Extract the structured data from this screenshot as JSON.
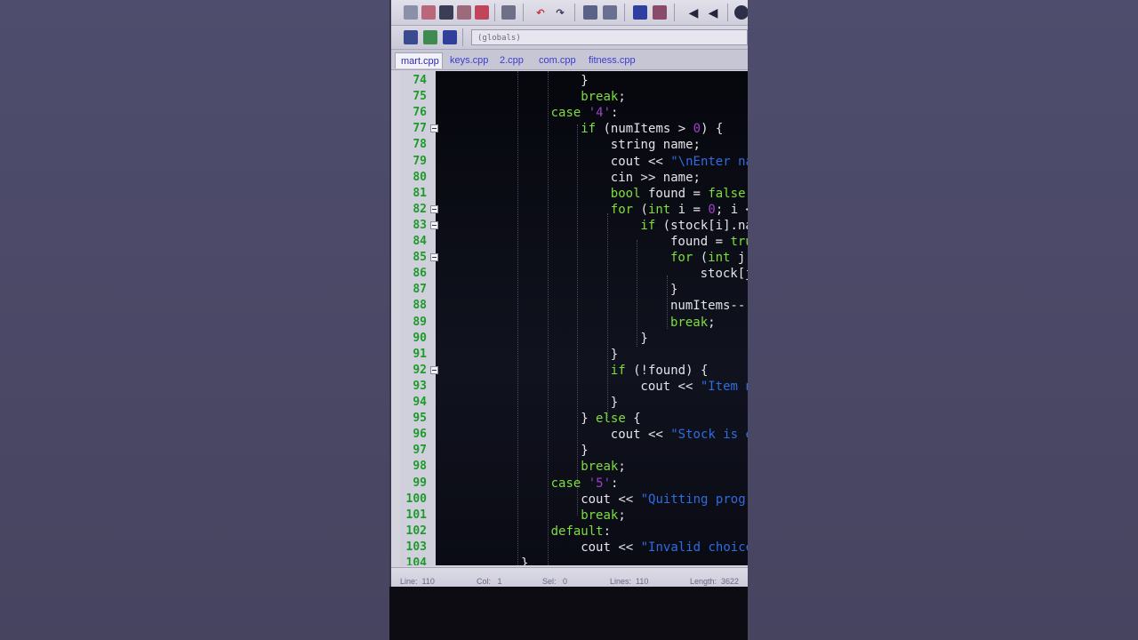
{
  "window": {
    "scope": "(globals)",
    "tabs": [
      "mart.cpp",
      "keys.cpp",
      "2.cpp",
      "com.cpp",
      "fitness.cpp"
    ]
  },
  "toolbar": {
    "icons": [
      "new-file-icon",
      "open-file-icon",
      "save-icon",
      "save-all-icon",
      "close-icon",
      "print-icon",
      "undo-icon",
      "redo-icon",
      "find-icon",
      "replace-icon",
      "indent-icon",
      "unindent-icon",
      "bookmark-icon",
      "bookmark-next-icon",
      "debug-icon"
    ]
  },
  "code": [
    {
      "ln": "74",
      "indent": 18,
      "tokens": [
        [
          "}",
          ""
        ]
      ]
    },
    {
      "ln": "75",
      "indent": 18,
      "tokens": [
        [
          "break",
          "kw"
        ],
        [
          ";",
          ""
        ]
      ]
    },
    {
      "ln": "76",
      "indent": 14,
      "tokens": [
        [
          "case ",
          "kw"
        ],
        [
          "'4'",
          "chr"
        ],
        [
          ":",
          ""
        ]
      ]
    },
    {
      "ln": "77",
      "indent": 18,
      "fold": true,
      "tokens": [
        [
          "if",
          "kw"
        ],
        [
          " (numItems > ",
          ""
        ],
        [
          "0",
          "chr"
        ],
        [
          ") {",
          ""
        ]
      ]
    },
    {
      "ln": "78",
      "indent": 22,
      "tokens": [
        [
          "string name;",
          ""
        ]
      ]
    },
    {
      "ln": "79",
      "indent": 22,
      "tokens": [
        [
          "cout << ",
          ""
        ],
        [
          "\"\\nEnter name",
          ""
        ]
      ]
    },
    {
      "ln": "80",
      "indent": 22,
      "tokens": [
        [
          "cin >> name;",
          ""
        ]
      ]
    },
    {
      "ln": "81",
      "indent": 22,
      "tokens": [
        [
          "bool",
          "kw"
        ],
        [
          " found = ",
          ""
        ],
        [
          "false",
          "kw"
        ],
        [
          ";",
          ""
        ]
      ]
    },
    {
      "ln": "82",
      "indent": 22,
      "fold": true,
      "tokens": [
        [
          "for",
          "kw"
        ],
        [
          " (",
          ""
        ],
        [
          "int",
          "kw"
        ],
        [
          " i = ",
          ""
        ],
        [
          "0",
          "chr"
        ],
        [
          "; i < n",
          ""
        ]
      ]
    },
    {
      "ln": "83",
      "indent": 26,
      "fold": true,
      "tokens": [
        [
          "if",
          "kw"
        ],
        [
          " (stock[i].name",
          ""
        ]
      ]
    },
    {
      "ln": "84",
      "indent": 30,
      "tokens": [
        [
          "found = ",
          ""
        ],
        [
          "true",
          "kw"
        ],
        [
          ";",
          ""
        ]
      ]
    },
    {
      "ln": "85",
      "indent": 30,
      "fold": true,
      "tokens": [
        [
          "for",
          "kw"
        ],
        [
          " (",
          ""
        ],
        [
          "int",
          "kw"
        ],
        [
          " j = ",
          ""
        ]
      ]
    },
    {
      "ln": "86",
      "indent": 34,
      "tokens": [
        [
          "stock[j]",
          ""
        ]
      ]
    },
    {
      "ln": "87",
      "indent": 30,
      "tokens": [
        [
          "}",
          ""
        ]
      ]
    },
    {
      "ln": "88",
      "indent": 30,
      "tokens": [
        [
          "numItems--;",
          ""
        ]
      ]
    },
    {
      "ln": "89",
      "indent": 30,
      "tokens": [
        [
          "break",
          "kw"
        ],
        [
          ";",
          ""
        ]
      ]
    },
    {
      "ln": "90",
      "indent": 26,
      "tokens": [
        [
          "}",
          ""
        ]
      ]
    },
    {
      "ln": "91",
      "indent": 22,
      "tokens": [
        [
          "}",
          ""
        ]
      ]
    },
    {
      "ln": "92",
      "indent": 22,
      "fold": true,
      "tokens": [
        [
          "if",
          "kw"
        ],
        [
          " (!found) {",
          ""
        ]
      ]
    },
    {
      "ln": "93",
      "indent": 26,
      "tokens": [
        [
          "cout << ",
          ""
        ],
        [
          "\"Item not",
          ""
        ]
      ]
    },
    {
      "ln": "94",
      "indent": 22,
      "tokens": [
        [
          "}",
          ""
        ]
      ]
    },
    {
      "ln": "95",
      "indent": 18,
      "tokens": [
        [
          "} ",
          ""
        ],
        [
          "else",
          "kw"
        ],
        [
          " {",
          ""
        ]
      ]
    },
    {
      "ln": "96",
      "indent": 22,
      "tokens": [
        [
          "cout << ",
          ""
        ],
        [
          "\"Stock is empt",
          ""
        ]
      ]
    },
    {
      "ln": "97",
      "indent": 18,
      "tokens": [
        [
          "}",
          ""
        ]
      ]
    },
    {
      "ln": "98",
      "indent": 18,
      "tokens": [
        [
          "break",
          "kw"
        ],
        [
          ";",
          ""
        ]
      ]
    },
    {
      "ln": "99",
      "indent": 14,
      "tokens": [
        [
          "case ",
          "kw"
        ],
        [
          "'5'",
          "chr"
        ],
        [
          ":",
          ""
        ]
      ]
    },
    {
      "ln": "100",
      "indent": 18,
      "tokens": [
        [
          "cout << ",
          ""
        ],
        [
          "\"Quitting program.",
          ""
        ]
      ]
    },
    {
      "ln": "101",
      "indent": 18,
      "tokens": [
        [
          "break",
          "kw"
        ],
        [
          ";",
          ""
        ]
      ]
    },
    {
      "ln": "102",
      "indent": 14,
      "tokens": [
        [
          "default",
          "kw"
        ],
        [
          ":",
          ""
        ]
      ]
    },
    {
      "ln": "103",
      "indent": 18,
      "tokens": [
        [
          "cout << ",
          ""
        ],
        [
          "\"Invalid choice.\\n",
          ""
        ]
      ]
    },
    {
      "ln": "104",
      "indent": 10,
      "tokens": [
        [
          "}",
          ""
        ]
      ]
    }
  ],
  "status": {
    "line": "Line:  110",
    "col": "Col:   1",
    "sel": "Sel:   0",
    "lines": "Lines:  110",
    "length": "Length:  3622"
  }
}
